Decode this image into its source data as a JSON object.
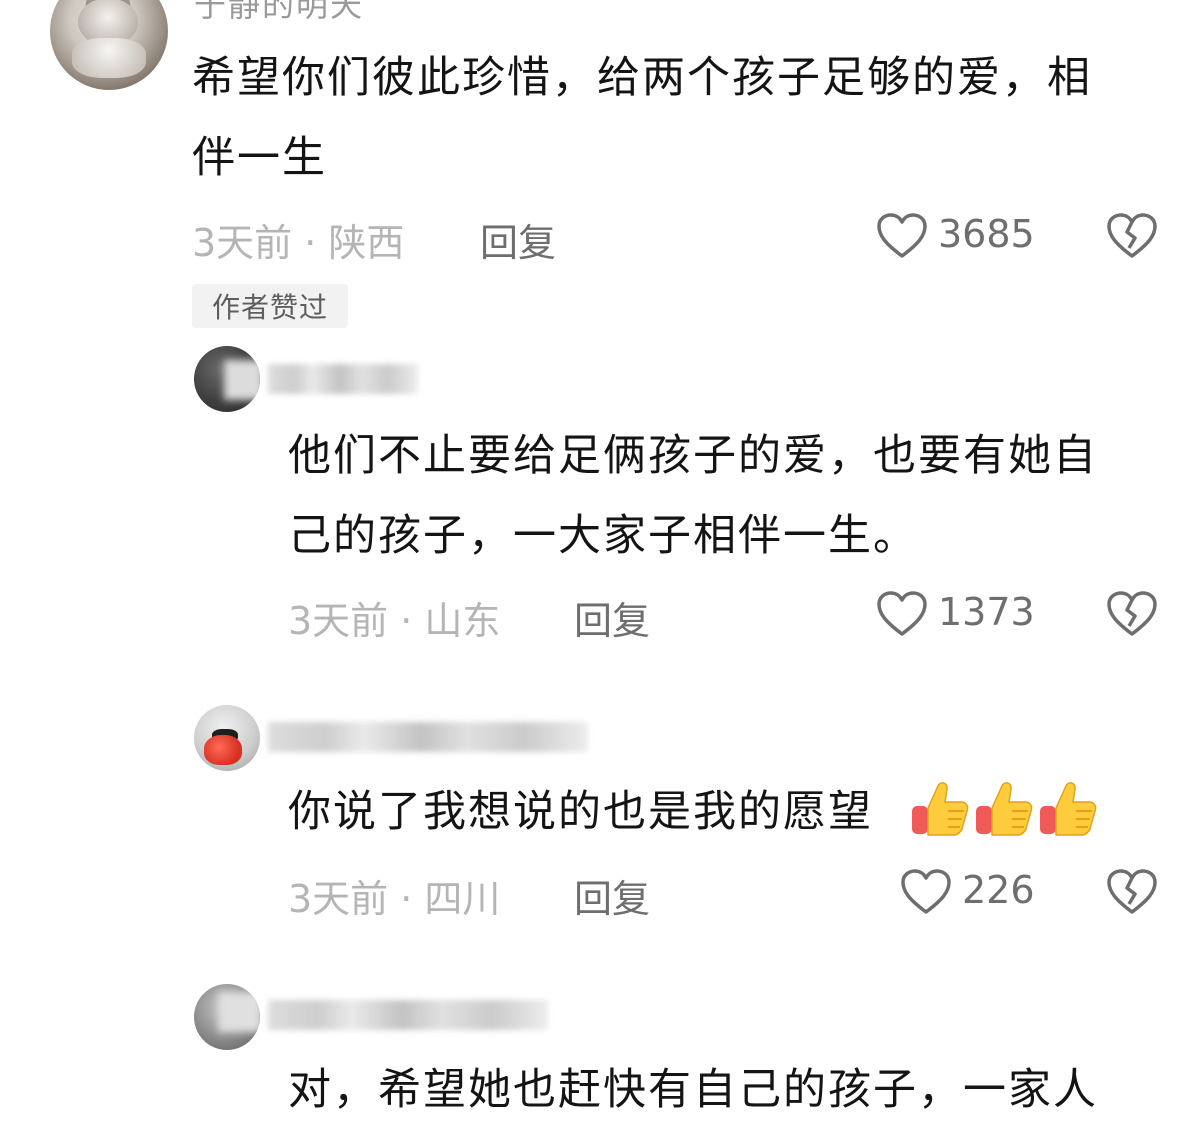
{
  "comments": [
    {
      "username": "于静的明天",
      "line1": "希望你们彼此珍惜，给两个孩子足够的爱，相",
      "line2": "伴一生",
      "meta": "3天前 · 陕西",
      "reply_label": "回复",
      "likes": "3685",
      "author_tag": "作者赞过",
      "icons": {
        "like": "heart-outline-icon",
        "dislike": "broken-heart-icon"
      }
    },
    {
      "username": "",
      "line1": "他们不止要给足俩孩子的爱，也要有她自",
      "line2": "己的孩子，一大家子相伴一生。",
      "meta": "3天前 · 山东",
      "reply_label": "回复",
      "likes": "1373"
    },
    {
      "username": "",
      "line1": "你说了我想说的也是我的愿望",
      "emoji": [
        "thumbs-up-icon",
        "thumbs-up-icon",
        "thumbs-up-icon"
      ],
      "meta": "3天前 · 四川",
      "reply_label": "回复",
      "likes": "226"
    },
    {
      "username": "",
      "line1": "对，希望她也赶快有自己的孩子，一家人"
    }
  ],
  "colors": {
    "text": "#141414",
    "meta": "#b5b5b5",
    "action": "#6e6e6e",
    "tag_bg": "#f2f2f2"
  }
}
